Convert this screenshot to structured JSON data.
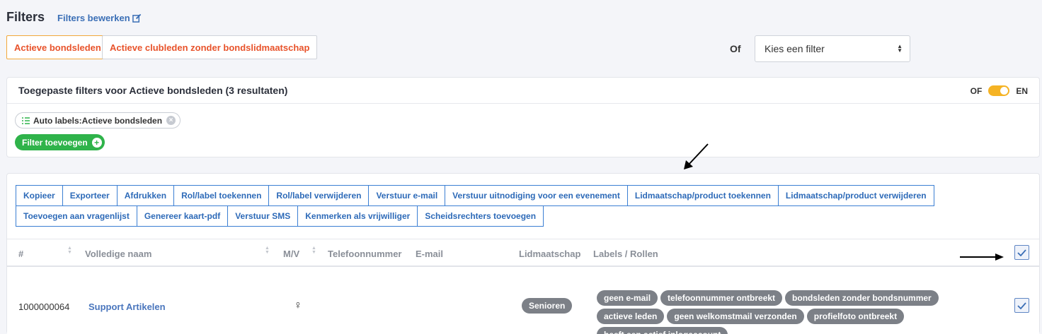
{
  "header": {
    "title": "Filters",
    "edit_link": "Filters bewerken"
  },
  "quick_filters": [
    {
      "label": "Actieve bondsleden",
      "active": true
    },
    {
      "label": "Actieve clubleden zonder bondslidmaatschap",
      "active": false
    }
  ],
  "or_label": "Of",
  "filter_select": {
    "value": "Kies een filter"
  },
  "applied": {
    "title": "Toegepaste filters voor Actieve bondsleden (3 resultaten)",
    "toggle_off": "OF",
    "toggle_on": "EN",
    "chip": "Auto labels:Actieve bondsleden",
    "add_filter": "Filter toevoegen"
  },
  "actions": [
    "Kopieer",
    "Exporteer",
    "Afdrukken",
    "Rol/label toekennen",
    "Rol/label verwijderen",
    "Verstuur e-mail",
    "Verstuur uitnodiging voor een evenement",
    "Lidmaatschap/product toekennen",
    "Lidmaatschap/product verwijderen",
    "Toevoegen aan vragenlijst",
    "Genereer kaart-pdf",
    "Verstuur SMS",
    "Kenmerken als vrijwilliger",
    "Scheidsrechters toevoegen"
  ],
  "table": {
    "columns": {
      "num": "#",
      "name": "Volledige naam",
      "gender": "M/V",
      "phone": "Telefoonnummer",
      "email": "E-mail",
      "membership": "Lidmaatschap",
      "labels": "Labels / Rollen"
    },
    "rows": [
      {
        "num": "1000000064",
        "name": "Support Artikelen",
        "gender": "♀",
        "membership": "Senioren",
        "labels": [
          "geen e-mail",
          "telefoonnummer ontbreekt",
          "bondsleden zonder bondsnummer",
          "actieve leden",
          "geen welkomstmail verzonden",
          "profielfoto ontbreekt",
          "heeft een actief inlogaccount"
        ]
      }
    ]
  },
  "colors": {
    "accent_orange": "#e8532b",
    "link_blue": "#3b6fb6",
    "green": "#2fb34a",
    "toggle_yellow": "#f5b324"
  }
}
